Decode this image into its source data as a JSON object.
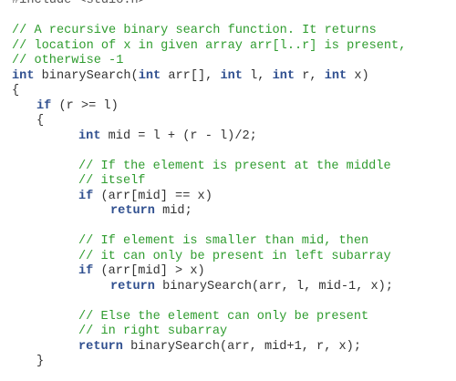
{
  "code": {
    "lines": [
      [
        "#include <stdio.h>"
      ],
      [
        ""
      ],
      [
        "// A recursive binary search function. It returns"
      ],
      [
        "// location of x in given array arr[l..r] is present,"
      ],
      [
        "// otherwise -1"
      ],
      [
        "int",
        " binarySearch(",
        "int",
        " arr[], ",
        "int",
        " l, ",
        "int",
        " r, ",
        "int",
        " x)"
      ],
      [
        "{"
      ],
      [
        "if",
        " (r >= l)"
      ],
      [
        "{"
      ],
      [
        "int",
        " mid = l + (r - l)/2;"
      ],
      [
        ""
      ],
      [
        "// If the element is present at the middle"
      ],
      [
        "// itself"
      ],
      [
        "if",
        " (arr[mid] == x)"
      ],
      [
        "return",
        " mid;"
      ],
      [
        ""
      ],
      [
        "// If element is smaller than mid, then"
      ],
      [
        "// it can only be present in left subarray"
      ],
      [
        "if",
        " (arr[mid] > x)"
      ],
      [
        "return",
        " binarySearch(arr, l, mid-1, x);"
      ],
      [
        ""
      ],
      [
        "// Else the element can only be present"
      ],
      [
        "// in right subarray"
      ],
      [
        "return",
        " binarySearch(arr, mid+1, r, x);"
      ],
      [
        "}"
      ]
    ]
  },
  "colors": {
    "comment": "#2f9c2f",
    "keyword": "#2f4f8f",
    "text": "#333333",
    "preprocessor": "#555555"
  }
}
